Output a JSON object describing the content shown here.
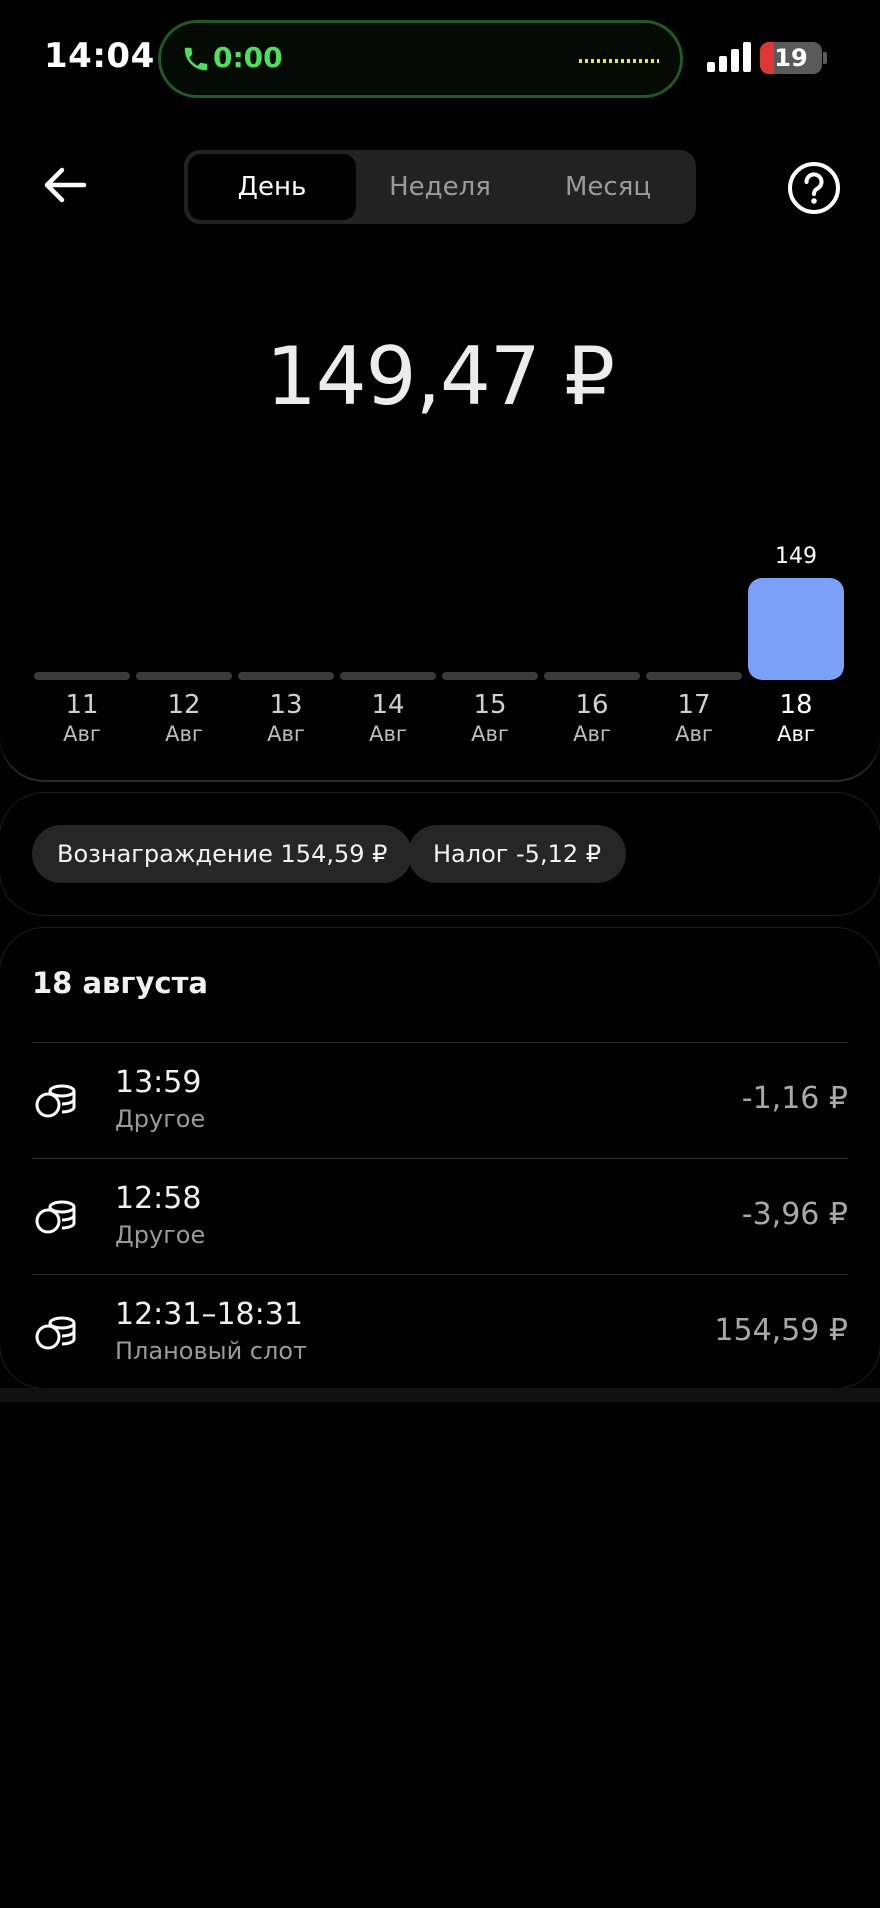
{
  "status_bar": {
    "time": "14:04",
    "call_timer": "0:00",
    "battery_level": "19"
  },
  "header": {
    "tabs": [
      {
        "label": "День",
        "active": true
      },
      {
        "label": "Неделя",
        "active": false
      },
      {
        "label": "Месяц",
        "active": false
      }
    ]
  },
  "total": "149,47 ₽",
  "chart_data": {
    "type": "bar",
    "categories": [
      "11 Авг",
      "12 Авг",
      "13 Авг",
      "14 Авг",
      "15 Авг",
      "16 Авг",
      "17 Авг",
      "18 Авг"
    ],
    "days": [
      {
        "day": "11",
        "month": "Авг"
      },
      {
        "day": "12",
        "month": "Авг"
      },
      {
        "day": "13",
        "month": "Авг"
      },
      {
        "day": "14",
        "month": "Авг"
      },
      {
        "day": "15",
        "month": "Авг"
      },
      {
        "day": "16",
        "month": "Авг"
      },
      {
        "day": "17",
        "month": "Авг"
      },
      {
        "day": "18",
        "month": "Авг"
      }
    ],
    "values": [
      0,
      0,
      0,
      0,
      0,
      0,
      0,
      149
    ],
    "value_labels": [
      "",
      "",
      "",
      "",
      "",
      "",
      "",
      "149"
    ],
    "selected_index": 7,
    "bar_color": "#7aa1f7",
    "track_color": "#3a3a3a"
  },
  "summary": {
    "reward": "Вознаграждение 154,59 ₽",
    "tax": "Налог -5,12 ₽"
  },
  "transactions": {
    "date": "18 августа",
    "items": [
      {
        "time": "13:59",
        "type": "Другое",
        "amount": "-1,16 ₽",
        "icon": "coins-icon"
      },
      {
        "time": "12:58",
        "type": "Другое",
        "amount": "-3,96 ₽",
        "icon": "coins-icon"
      },
      {
        "time": "12:31–18:31",
        "type": "Плановый слот",
        "amount": "154,59 ₽",
        "icon": "coins-icon"
      }
    ]
  },
  "colors": {
    "background": "#000000",
    "accent_bar": "#7aa1f7",
    "call_green": "#4ce05c",
    "battery_red": "#e03535"
  }
}
